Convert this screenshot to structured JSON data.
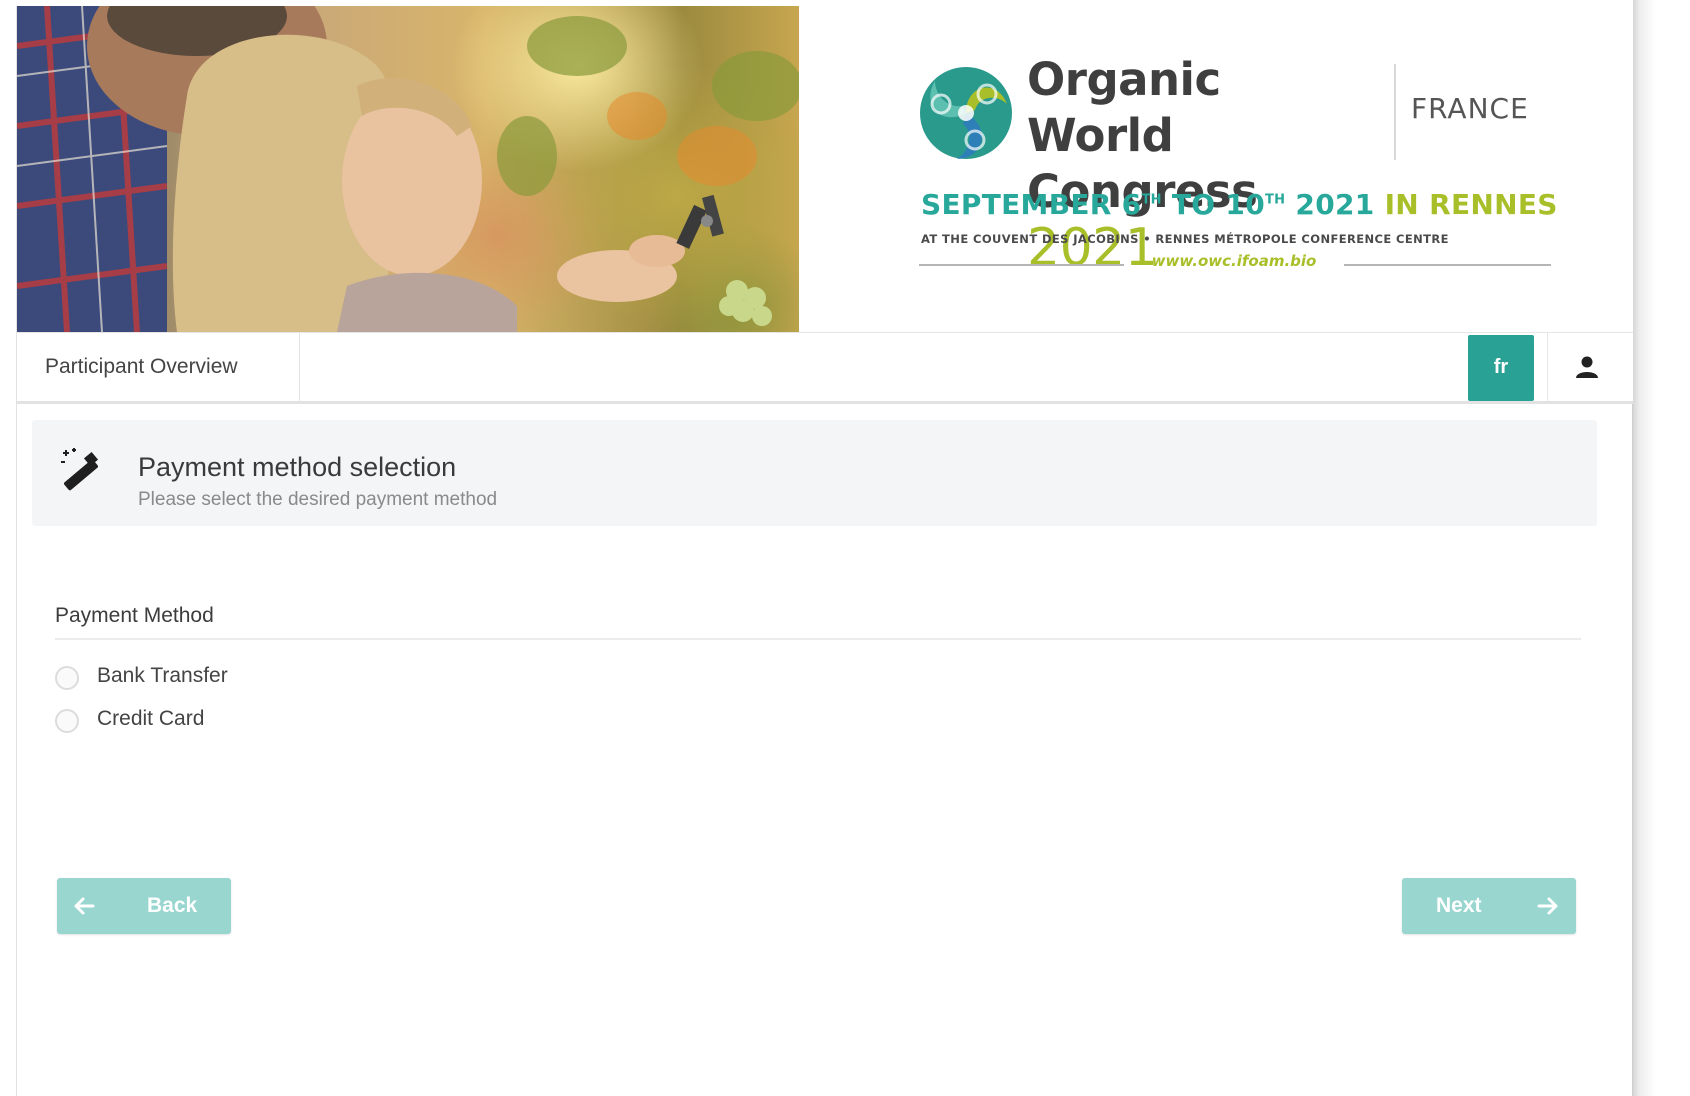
{
  "banner": {
    "logo_title_line1": "Organic World",
    "logo_title_line2": "Congress",
    "logo_year": "2021",
    "country": "FRANCE",
    "dates_prefix": "SEPTEMBER 6",
    "dates_sup1": "TH",
    "dates_mid": " TO 10",
    "dates_sup2": "TH",
    "dates_year": " 2021 ",
    "dates_city": "IN RENNES",
    "venue": "AT THE COUVENT DES JACOBINS • RENNES MÉTROPOLE CONFERENCE CENTRE",
    "website": "www.owc.ifoam.bio"
  },
  "nav": {
    "tab_label": "Participant Overview",
    "lang_label": "fr",
    "user_icon": "user-icon"
  },
  "step": {
    "icon": "magic-wand-icon",
    "title": "Payment method selection",
    "subtitle": "Please select the desired payment method"
  },
  "form": {
    "field_label": "Payment Method",
    "options": [
      {
        "label": "Bank Transfer",
        "selected": false
      },
      {
        "label": "Credit Card",
        "selected": false
      }
    ]
  },
  "actions": {
    "back_label": "Back",
    "next_label": "Next",
    "back_icon": "arrow-left-icon",
    "next_icon": "arrow-right-icon"
  },
  "colors": {
    "accent": "#2aa195",
    "button_disabled": "#99d6cf",
    "logo_teal": "#27a89b",
    "logo_green": "#a9bf2a"
  }
}
